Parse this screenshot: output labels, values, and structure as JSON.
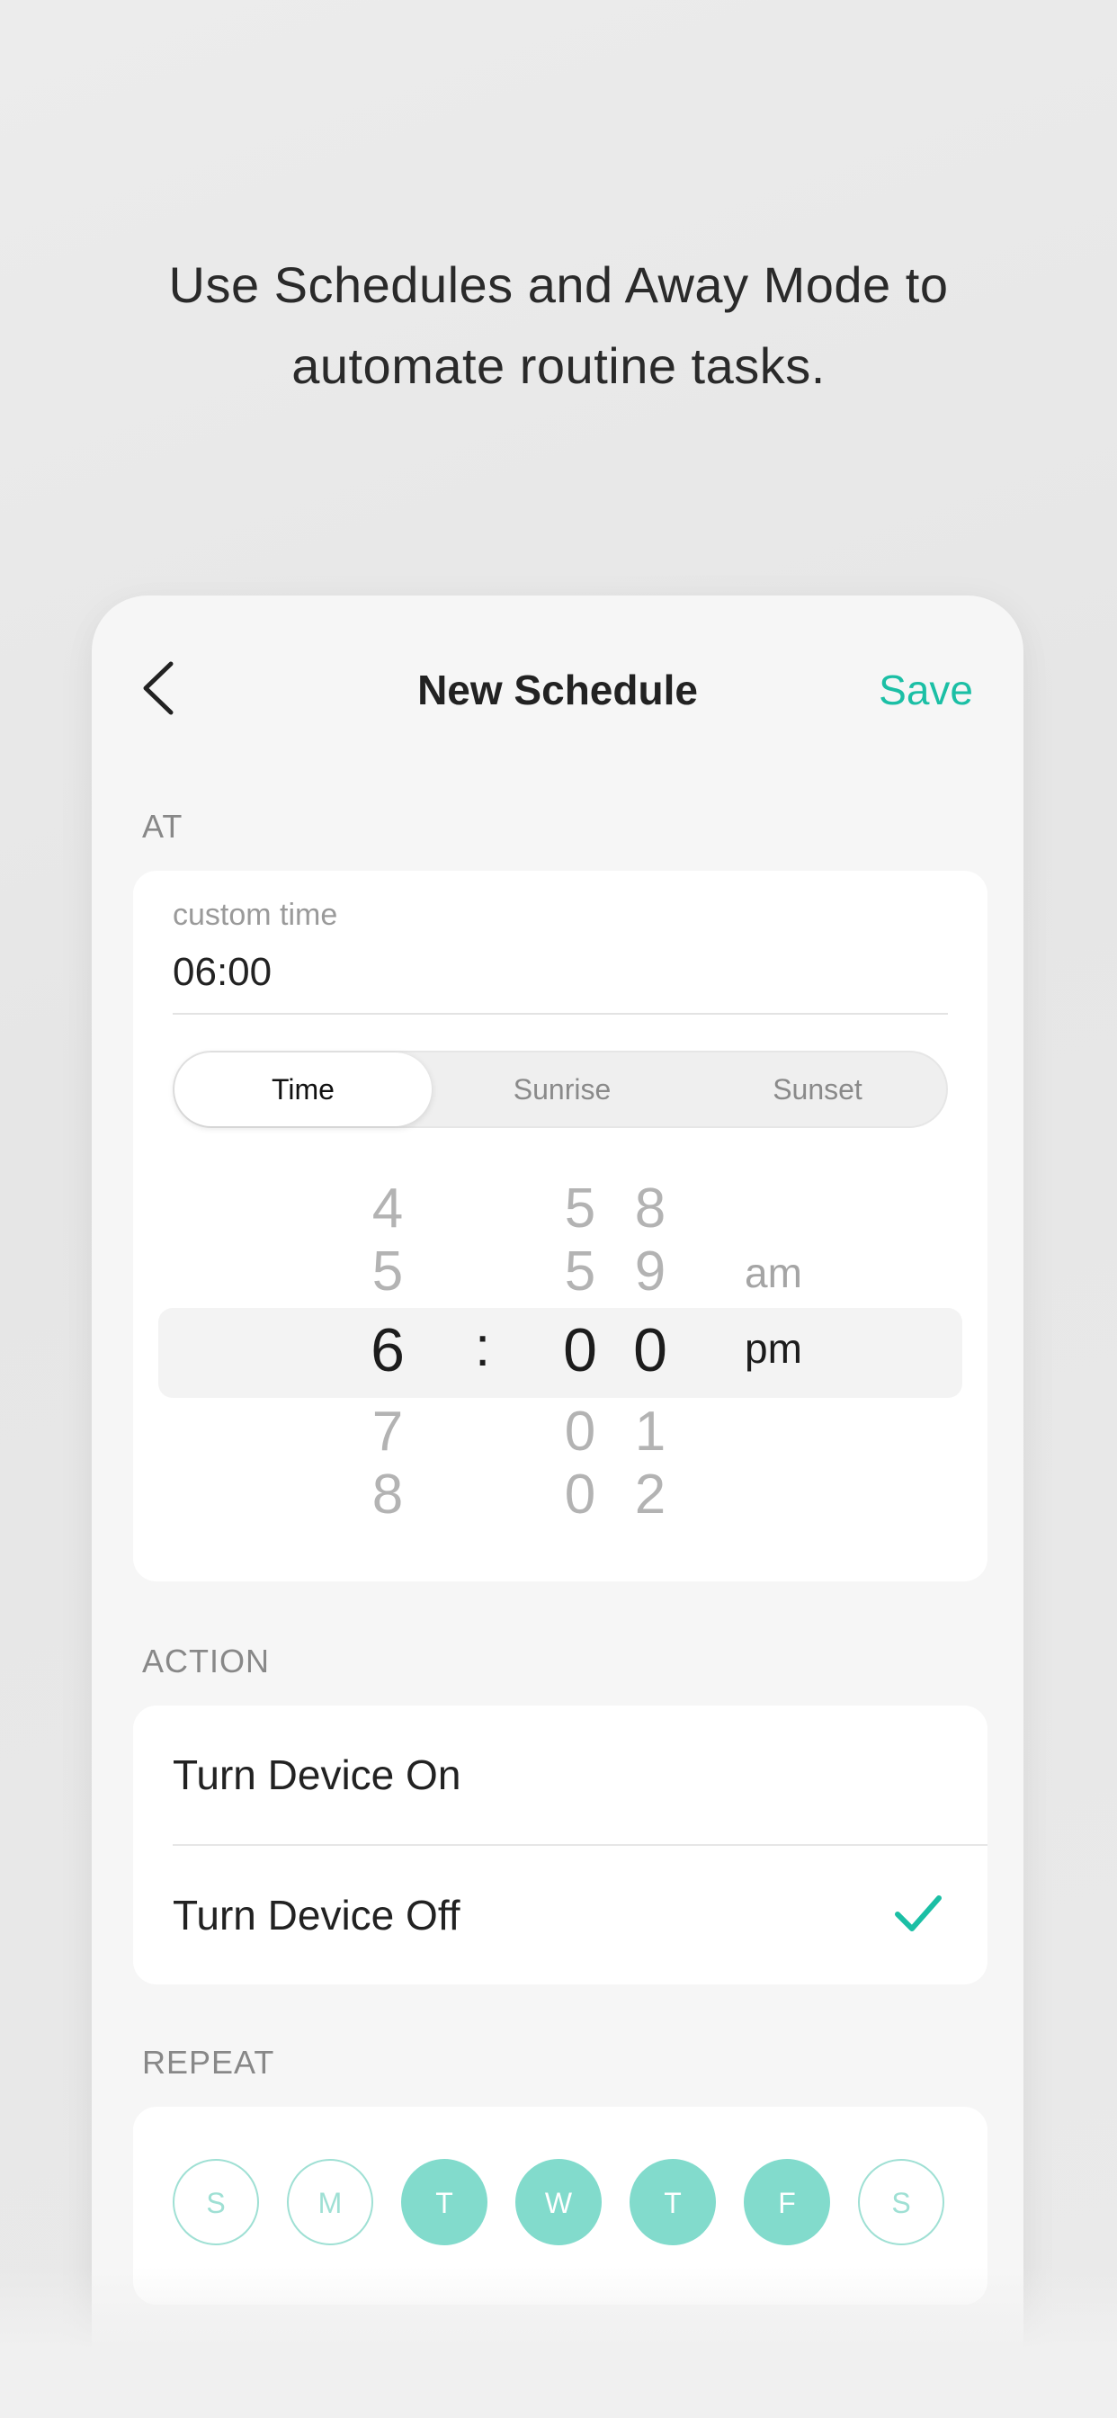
{
  "headline": {
    "line1": "Use Schedules and Away Mode to",
    "line2": "automate routine tasks."
  },
  "nav": {
    "back_icon": "chevron-left-icon",
    "title": "New Schedule",
    "save_label": "Save"
  },
  "at": {
    "section_label": "AT",
    "custom_label": "custom time",
    "time_value": "06:00",
    "segments": [
      {
        "label": "Time",
        "active": true
      },
      {
        "label": "Sunrise",
        "active": false
      },
      {
        "label": "Sunset",
        "active": false
      }
    ],
    "picker": {
      "hours": [
        "4",
        "5",
        "6",
        "7",
        "8"
      ],
      "minutes_tens": [
        "5",
        "5",
        "0",
        "0",
        "0"
      ],
      "minutes_ones": [
        "8",
        "9",
        "0",
        "1",
        "2"
      ],
      "separator": ":",
      "period_options": [
        "am",
        "pm"
      ],
      "selected_period": "pm"
    }
  },
  "action": {
    "section_label": "ACTION",
    "options": [
      {
        "label": "Turn Device On",
        "selected": false
      },
      {
        "label": "Turn Device Off",
        "selected": true
      }
    ],
    "check_icon": "checkmark-icon"
  },
  "repeat": {
    "section_label": "REPEAT",
    "days": [
      {
        "label": "S",
        "active": false
      },
      {
        "label": "M",
        "active": false
      },
      {
        "label": "T",
        "active": true
      },
      {
        "label": "W",
        "active": true
      },
      {
        "label": "T",
        "active": true
      },
      {
        "label": "F",
        "active": true
      },
      {
        "label": "S",
        "active": false
      }
    ]
  },
  "colors": {
    "accent": "#1bbfa5",
    "day_active": "#82dbcc",
    "day_inactive_border": "#9fe0d4"
  }
}
